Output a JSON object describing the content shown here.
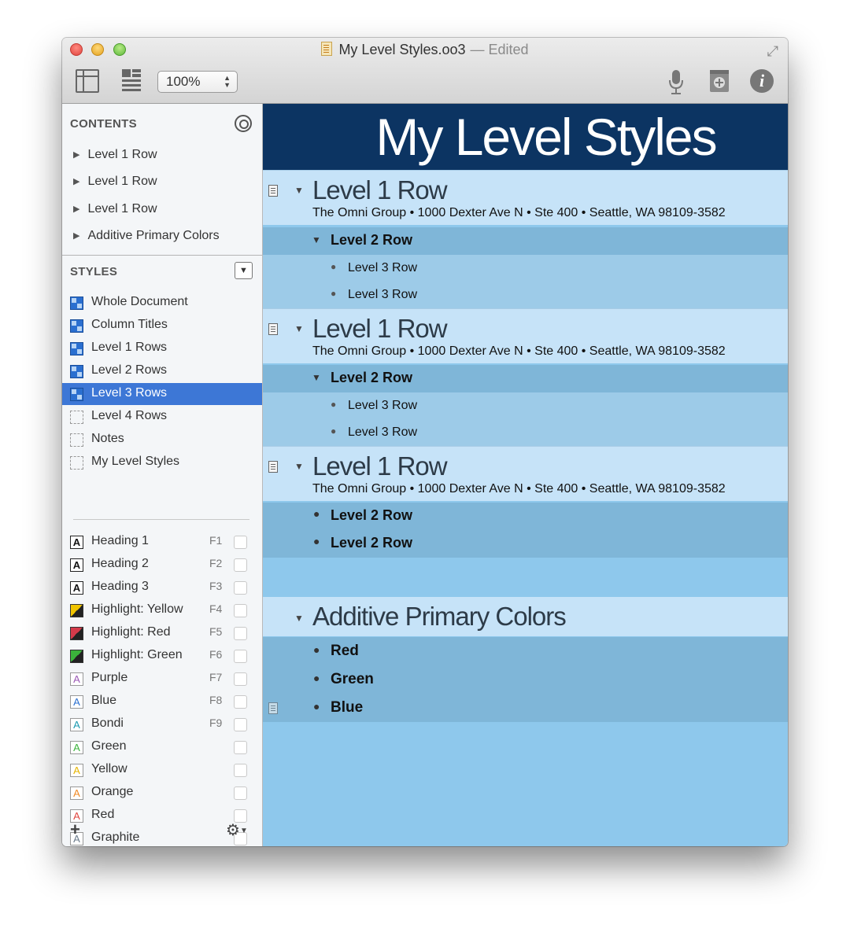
{
  "window": {
    "title": "My Level Styles.oo3",
    "edited_label": "— Edited"
  },
  "toolbar": {
    "zoom_value": "100%",
    "info_label": "i"
  },
  "sidebar": {
    "contents_header": "CONTENTS",
    "contents_items": [
      "Level 1 Row",
      "Level 1 Row",
      "Level 1 Row",
      "Additive Primary Colors"
    ],
    "styles_header": "STYLES",
    "styles": [
      {
        "label": "Whole Document",
        "swatch": "blue"
      },
      {
        "label": "Column Titles",
        "swatch": "blue"
      },
      {
        "label": "Level 1 Rows",
        "swatch": "blue"
      },
      {
        "label": "Level 2 Rows",
        "swatch": "blue"
      },
      {
        "label": "Level 3 Rows",
        "swatch": "blue",
        "selected": true
      },
      {
        "label": "Level 4 Rows",
        "swatch": "empty"
      },
      {
        "label": "Notes",
        "swatch": "empty"
      },
      {
        "label": "My Level Styles",
        "swatch": "empty"
      }
    ],
    "named_styles": [
      {
        "label": "Heading 1",
        "fkey": "F1",
        "letter": "A",
        "swatch_color": "#111111"
      },
      {
        "label": "Heading 2",
        "fkey": "F2",
        "letter": "A",
        "swatch_color": "#111111"
      },
      {
        "label": "Heading 3",
        "fkey": "F3",
        "letter": "A",
        "swatch_color": "#111111"
      },
      {
        "label": "Highlight: Yellow",
        "fkey": "F4",
        "letter": "",
        "swatch_color": "#f0c400"
      },
      {
        "label": "Highlight: Red",
        "fkey": "F5",
        "letter": "",
        "swatch_color": "#d43a4a"
      },
      {
        "label": "Highlight: Green",
        "fkey": "F6",
        "letter": "",
        "swatch_color": "#3bb33b"
      },
      {
        "label": "Purple",
        "fkey": "F7",
        "letter": "A",
        "swatch_color": "#9b59b6"
      },
      {
        "label": "Blue",
        "fkey": "F8",
        "letter": "A",
        "swatch_color": "#2a6fd0"
      },
      {
        "label": "Bondi",
        "fkey": "F9",
        "letter": "A",
        "swatch_color": "#1a9ab0"
      },
      {
        "label": "Green",
        "fkey": "",
        "letter": "A",
        "swatch_color": "#3bb33b"
      },
      {
        "label": "Yellow",
        "fkey": "",
        "letter": "A",
        "swatch_color": "#e6b400"
      },
      {
        "label": "Orange",
        "fkey": "",
        "letter": "A",
        "swatch_color": "#f08a24"
      },
      {
        "label": "Red",
        "fkey": "",
        "letter": "A",
        "swatch_color": "#e0443e"
      },
      {
        "label": "Graphite",
        "fkey": "",
        "letter": "A",
        "swatch_color": "#6a7a8a"
      }
    ],
    "add_label": "+",
    "gear_label": "⚙"
  },
  "document": {
    "title": "My Level Styles",
    "level1_sections": [
      {
        "title": "Level 1 Row",
        "note": "The Omni Group • 1000 Dexter Ave N • Ste 400 • Seattle, WA 98109-3582",
        "level2": "Level 2 Row",
        "level3": [
          "Level 3 Row",
          "Level 3 Row"
        ]
      },
      {
        "title": "Level 1 Row",
        "note": "The Omni Group • 1000 Dexter Ave N • Ste 400 • Seattle, WA 98109-3582",
        "level2": "Level 2 Row",
        "level3": [
          "Level 3 Row",
          "Level 3 Row"
        ]
      },
      {
        "title": "Level 1 Row",
        "note": "The Omni Group • 1000 Dexter Ave N • Ste 400 • Seattle, WA 98109-3582",
        "level2_items": [
          "Level 2 Row",
          "Level 2 Row"
        ]
      }
    ],
    "apc_title": "Additive Primary Colors",
    "colors": [
      "Red",
      "Green",
      "Blue"
    ]
  }
}
